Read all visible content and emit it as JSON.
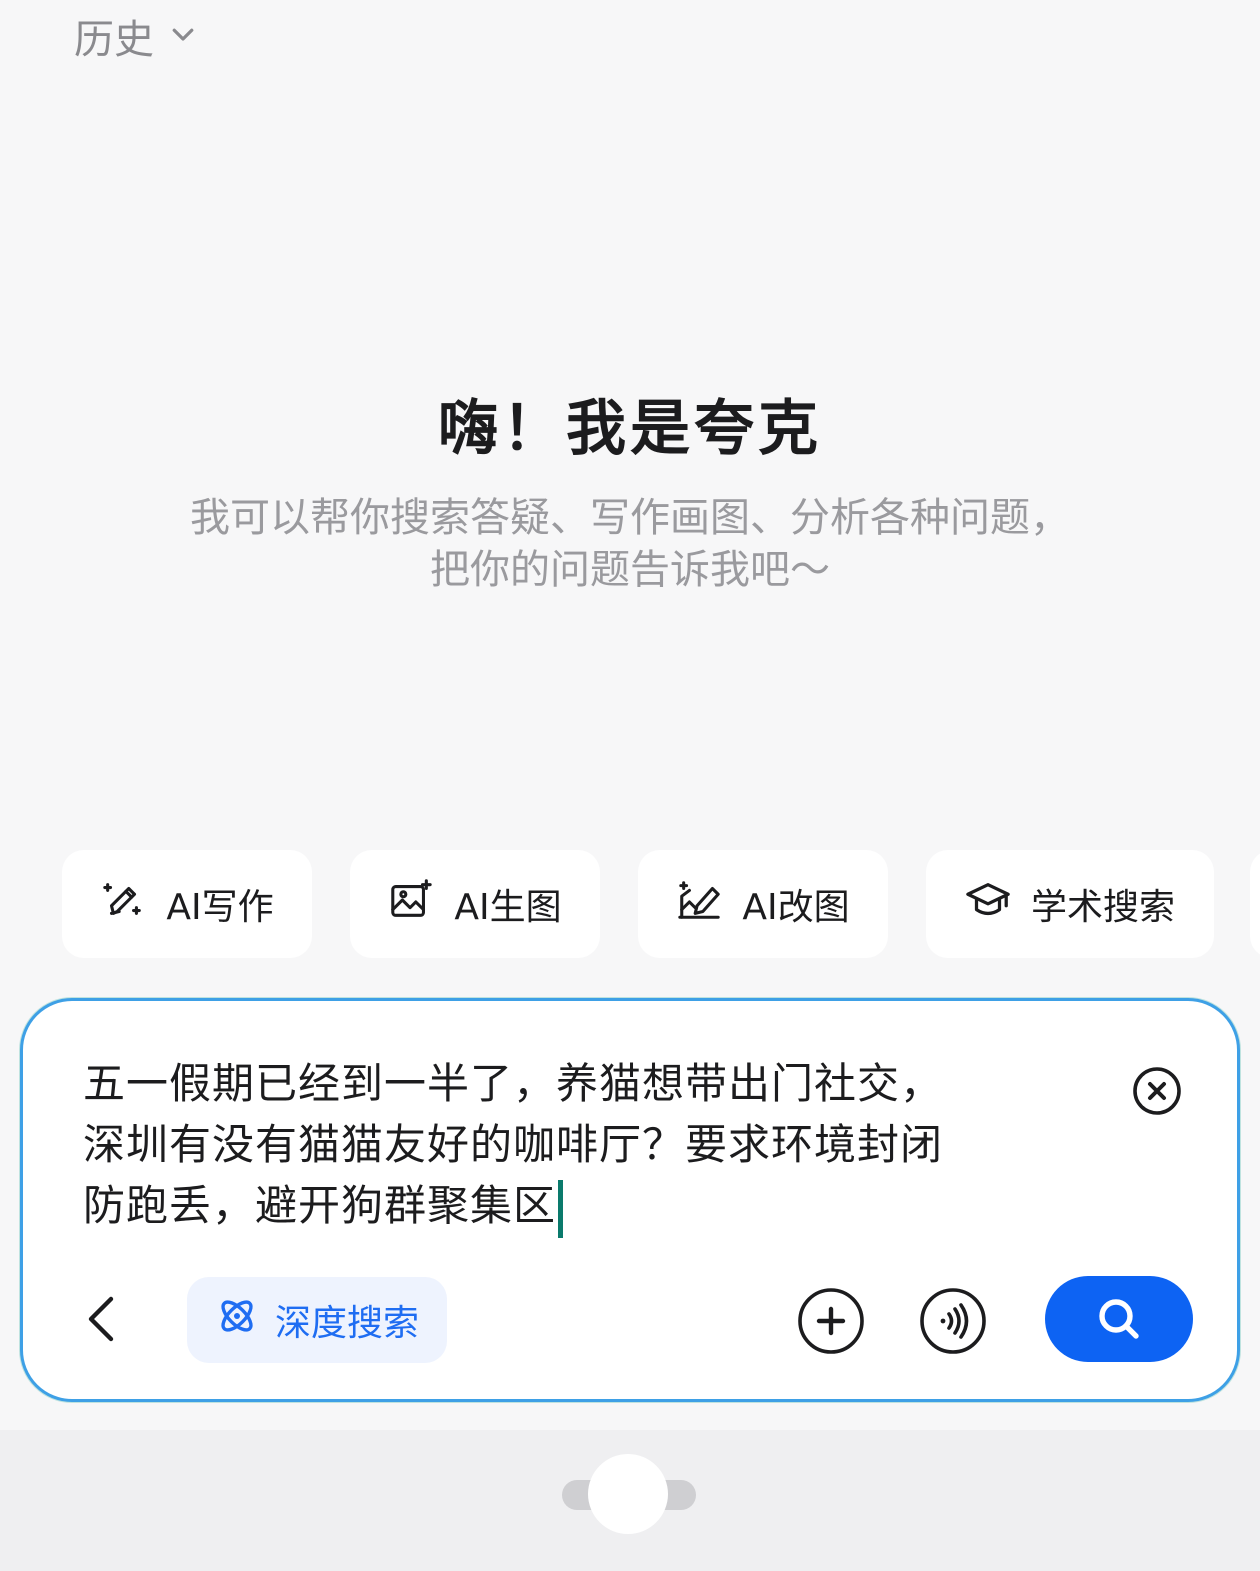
{
  "header": {
    "history_label": "历史"
  },
  "greeting": {
    "title": "嗨！我是夸克",
    "subtitle_line1": "我可以帮你搜索答疑、写作画图、分析各种问题，",
    "subtitle_line2": "把你的问题告诉我吧～"
  },
  "chips": [
    {
      "label": "AI写作",
      "icon": "ai-write-icon"
    },
    {
      "label": "AI生图",
      "icon": "ai-image-generate-icon"
    },
    {
      "label": "AI改图",
      "icon": "ai-image-edit-icon"
    },
    {
      "label": "学术搜索",
      "icon": "graduation-cap-icon"
    }
  ],
  "input": {
    "line1": "五一假期已经到一半了，养猫想带出门社交，",
    "line2": "深圳有没有猫猫友好的咖啡厅？要求环境封闭",
    "line3": "防跑丢，避开狗群聚集区"
  },
  "toolbar": {
    "deep_search_label": "深度搜索"
  },
  "colors": {
    "accent": "#0d63f3",
    "deep_search_text": "#1f6df2",
    "deep_search_bg": "#eef3fe",
    "input_border": "#3ea0e6",
    "caret": "#0a7a6c"
  }
}
